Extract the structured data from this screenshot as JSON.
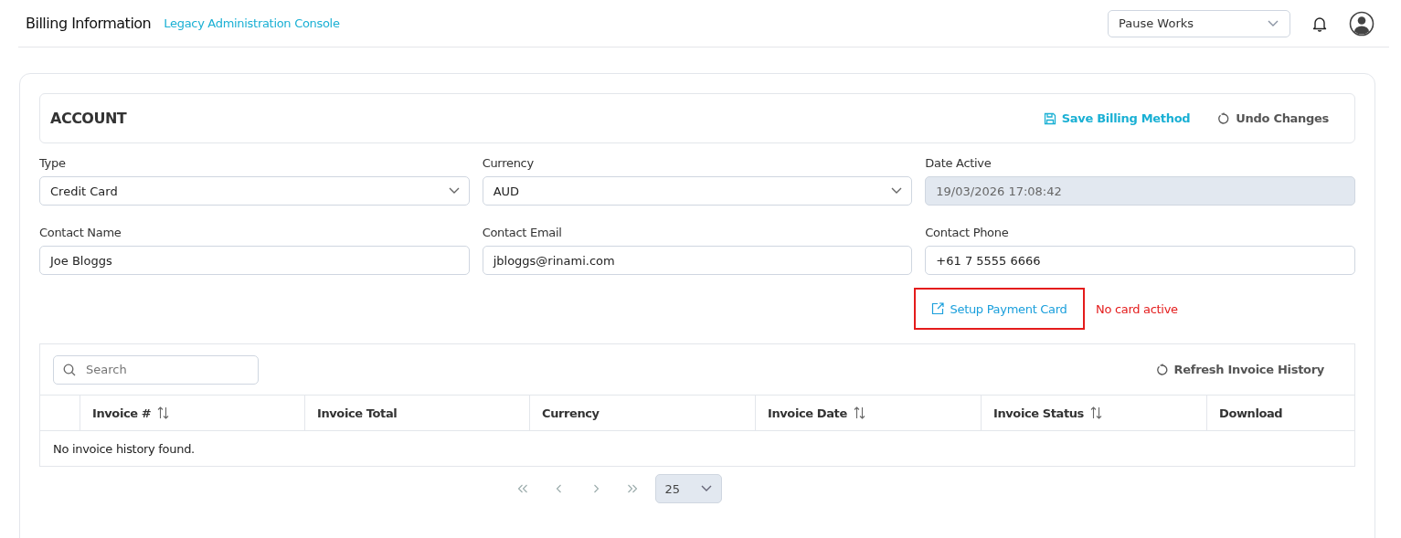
{
  "header": {
    "title": "Billing Information",
    "subtitle": "Legacy Administration Console",
    "workspace_select": {
      "value": "Pause Works"
    }
  },
  "account": {
    "title": "ACCOUNT",
    "actions": [
      {
        "kind": "save",
        "label": "Save Billing Method"
      },
      {
        "kind": "undo",
        "label": "Undo Changes"
      }
    ],
    "fields": [
      {
        "kind": "select",
        "label": "Type",
        "value": "Credit Card",
        "disabled": false
      },
      {
        "kind": "select",
        "label": "Currency",
        "value": "AUD",
        "disabled": false
      },
      {
        "kind": "text",
        "label": "Date Active",
        "value": "19/03/2026 17:08:42",
        "disabled": true
      },
      {
        "kind": "text",
        "label": "Contact Name",
        "value": "Joe Bloggs",
        "disabled": false
      },
      {
        "kind": "text",
        "label": "Contact Email",
        "value": "jbloggs@rinami.com",
        "disabled": false
      },
      {
        "kind": "text",
        "label": "Contact Phone",
        "value": "+61 7 5555 6666",
        "disabled": false
      }
    ],
    "payment_card": {
      "label": "Setup Payment Card",
      "highlighted": true,
      "status": "No card active"
    }
  },
  "invoices": {
    "search": {
      "placeholder": "Search"
    },
    "refresh": "Refresh Invoice History",
    "columns": [
      {
        "label": "Invoice #",
        "sortable": true
      },
      {
        "label": "Invoice Total",
        "sortable": false
      },
      {
        "label": "Currency",
        "sortable": false
      },
      {
        "label": "Invoice Date",
        "sortable": true
      },
      {
        "label": "Invoice Status",
        "sortable": true
      },
      {
        "label": "Download",
        "sortable": false
      }
    ],
    "empty_message": "No invoice history found.",
    "pagination": {
      "page_size": "25"
    }
  }
}
